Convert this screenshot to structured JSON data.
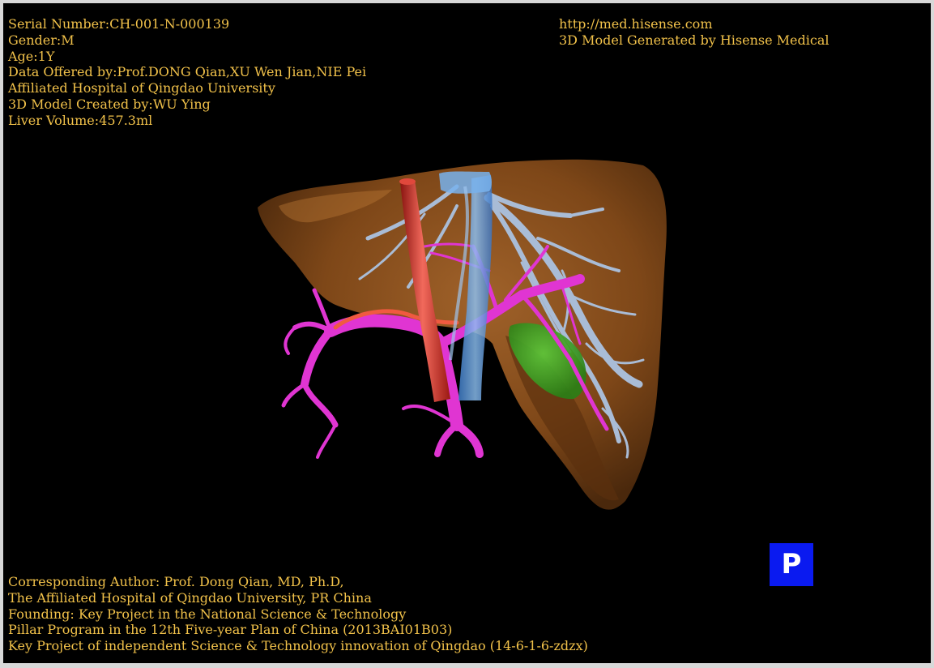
{
  "header_left": {
    "serial_number": "Serial Number:CH-001-N-000139",
    "gender": "Gender:M",
    "age": "Age:1Y",
    "data_offered_by": "Data Offered by:Prof.DONG Qian,XU Wen Jian,NIE Pei",
    "hospital": "Affiliated Hospital of Qingdao University",
    "model_created_by": "3D Model Created by:WU Ying",
    "liver_volume": "Liver Volume:457.3ml"
  },
  "header_right": {
    "url": "http://med.hisense.com",
    "generator": "3D Model Generated by Hisense Medical"
  },
  "footer_left": {
    "line1": "Corresponding Author: Prof. Dong Qian, MD, Ph.D,",
    "line2": "The Affiliated Hospital of Qingdao University, PR China",
    "line3": "Founding: Key Project in the National Science & Technology",
    "line4": "Pillar Program in the 12th Five-year Plan of China (2013BAI01B03)",
    "line5": "Key Project of independent Science & Technology innovation of Qingdao (14-6-1-6-zdzx)"
  },
  "view_badge": {
    "label": "P",
    "color": "#0a1af0"
  },
  "colors": {
    "background": "#000000",
    "frame": "#d8d8d8",
    "text": "#f2c24a",
    "liver": "#8a4f1c",
    "artery": "#d8332b",
    "portal_vein": "#e035d2",
    "hepatic_vein": "#a9bcd6",
    "vena_cava": "#5f9de0",
    "lesion": "#39a31f"
  }
}
